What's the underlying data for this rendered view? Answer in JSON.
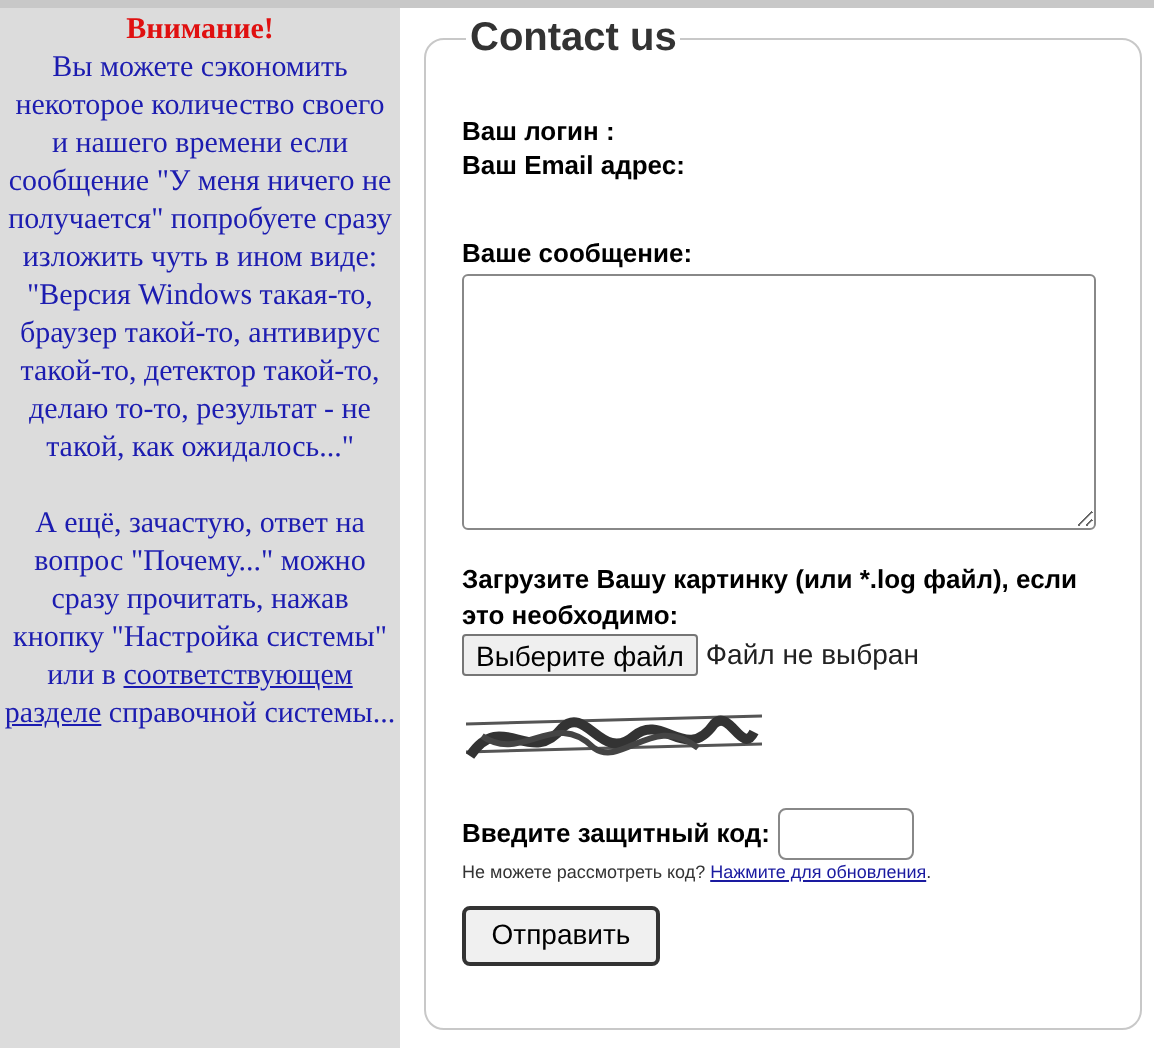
{
  "sidebar": {
    "heading": "Внимание!",
    "paragraphs": [
      [
        {
          "kind": "text",
          "text": "Вы можете сэкономить некоторое количество своего и нашего времени если сообщение \"У меня ничего не получается\" попробуете сразу изложить чуть в ином виде: \"Версия Windows такая-то, браузер такой-то, антивирус такой-то, детектор такой-то, делаю то-то, результат - не такой, как ожидалось...\""
        }
      ],
      [
        {
          "kind": "text",
          "text": "А ещё, зачастую, ответ на вопрос \"Почему...\" можно сразу прочитать, нажав кнопку \"Настройка системы\" или в"
        },
        {
          "kind": "link",
          "text": "соответствующем"
        },
        {
          "kind": "link",
          "text": "разделе"
        },
        {
          "kind": "text",
          "text": "справочной системы..."
        }
      ]
    ]
  },
  "form": {
    "legend": "Contact us",
    "login_label": "Ваш логин :",
    "email_label": "Ваш Email адрес:",
    "message_label": "Ваше сообщение:",
    "upload_label": "Загрузите Вашу картинку (или *.log файл), если это необходимо:",
    "file_button": "Выберите файл",
    "file_status": "Файл не выбран",
    "code_label": "Введите защитный код:",
    "refresh_hint": "Не можете рассмотреть код?",
    "refresh_link": "Нажмите для обновления",
    "refresh_end": ".",
    "submit": "Отправить"
  }
}
